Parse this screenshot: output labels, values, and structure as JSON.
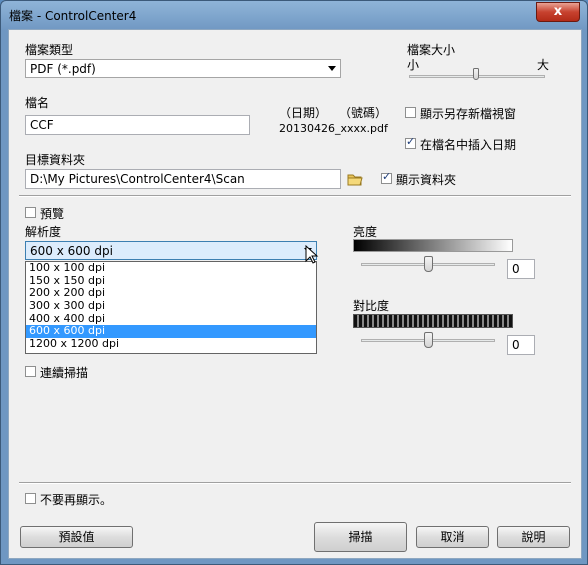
{
  "window": {
    "title": "檔案 - ControlCenter4",
    "close_glyph": "x"
  },
  "file_type": {
    "label": "檔案類型",
    "value": "PDF (*.pdf)"
  },
  "file_size": {
    "label": "檔案大小",
    "small": "小",
    "large": "大",
    "level": 0.5
  },
  "file_name": {
    "label": "檔名",
    "value": "CCF",
    "date_hint": "（日期）",
    "number_hint": "（號碼）",
    "example": "20130426_xxxx.pdf"
  },
  "show_save_as": {
    "label": "顯示另存新檔視窗",
    "checked": false
  },
  "insert_date": {
    "label": "在檔名中插入日期",
    "checked": true
  },
  "dest_folder": {
    "label": "目標資料夾",
    "value": "D:\\My Pictures\\ControlCenter4\\Scan"
  },
  "show_folder": {
    "label": "顯示資料夾",
    "checked": true
  },
  "preview": {
    "label": "預覽",
    "checked": false
  },
  "resolution": {
    "label": "解析度",
    "value": "600 x 600 dpi",
    "options": [
      "100 x 100 dpi",
      "150 x 150 dpi",
      "200 x 200 dpi",
      "300 x 300 dpi",
      "400 x 400 dpi",
      "600 x 600 dpi",
      "1200 x 1200 dpi"
    ],
    "selected_index": 5
  },
  "brightness": {
    "label": "亮度",
    "value": "0"
  },
  "contrast": {
    "label": "對比度",
    "value": "0"
  },
  "continuous": {
    "label": "連續掃描",
    "checked": false
  },
  "dont_show": {
    "label": "不要再顯示。",
    "checked": false
  },
  "buttons": {
    "default": "預設值",
    "scan": "掃描",
    "cancel": "取消",
    "help": "說明"
  },
  "colors": {
    "selection": "#3399ff",
    "close": "#c7422f"
  }
}
